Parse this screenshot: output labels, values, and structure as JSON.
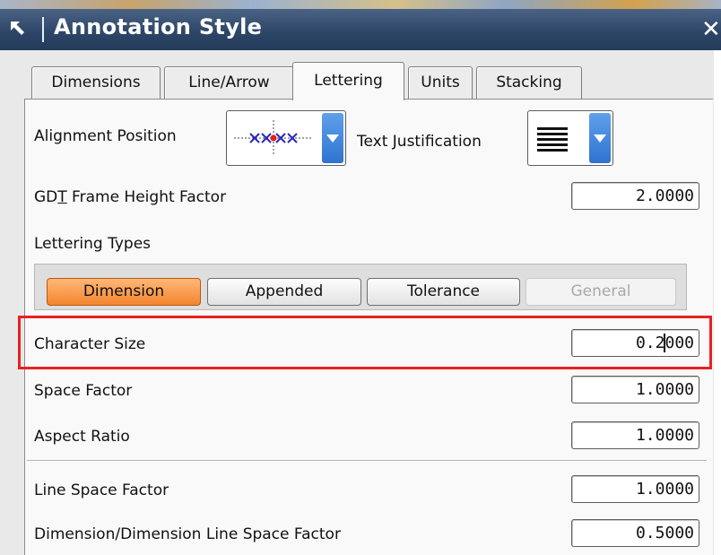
{
  "window": {
    "title": "Annotation Style",
    "close_glyph": "✕"
  },
  "tabs": [
    {
      "label": "Dimensions",
      "active": false
    },
    {
      "label": "Line/Arrow",
      "active": false
    },
    {
      "label": "Lettering",
      "active": true
    },
    {
      "label": "Units",
      "active": false
    },
    {
      "label": "Stacking",
      "active": false
    }
  ],
  "alignment": {
    "label": "Alignment Position",
    "icon": "alignment-xxx-icon"
  },
  "justification": {
    "label": "Text Justification",
    "icon": "justify-lines-icon"
  },
  "gdt": {
    "label_prefix": "GD",
    "label_mnemonic": "T",
    "label_suffix": " Frame Height Factor",
    "value": "2.0000"
  },
  "lettering_types": {
    "label": "Lettering Types",
    "buttons": [
      {
        "label": "Dimension",
        "state": "selected"
      },
      {
        "label": "Appended",
        "state": "normal"
      },
      {
        "label": "Tolerance",
        "state": "normal"
      },
      {
        "label": "General",
        "state": "disabled"
      }
    ]
  },
  "character_size": {
    "label": "Character Size",
    "value_before_cursor": "0.2",
    "value_after_cursor": "000"
  },
  "space_factor": {
    "label": "Space Factor",
    "value": "1.0000"
  },
  "aspect_ratio": {
    "label": "Aspect Ratio",
    "value": "1.0000"
  },
  "line_space_factor": {
    "label": "Line Space Factor",
    "value": "1.0000"
  },
  "dim_line_space_factor": {
    "label": "Dimension/Dimension Line Space Factor",
    "value": "0.5000"
  },
  "colors": {
    "title_bar": "#2c4567",
    "selected_button": "#f4842e",
    "highlight_box": "#e8211f",
    "dropdown_button": "#2f73d0"
  }
}
